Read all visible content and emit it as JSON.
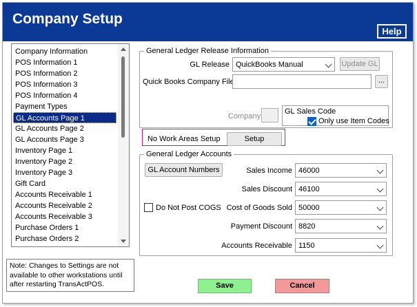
{
  "window": {
    "title": "Company Setup",
    "help_label": "Help",
    "colors": {
      "titlebar": "#0a3a96",
      "selection": "#0a2a8a",
      "save": "#8ef08e",
      "cancel": "#f29a9a",
      "highlight_border": "#c81c6a"
    }
  },
  "sidebar": {
    "items": [
      "Company Information",
      "POS Information 1",
      "POS Information 2",
      "POS Information 3",
      "POS Information 4",
      "Payment Types",
      "GL Accounts Page 1",
      "GL Accounts Page 2",
      "GL Accounts Page 3",
      "Inventory Page 1",
      "Inventory Page 2",
      "Inventory Page 3",
      "Gift Card",
      "Accounts Receivable 1",
      "Accounts Receivable 2",
      "Accounts Receivable 3",
      "Purchase Orders 1",
      "Purchase Orders 2"
    ],
    "selected": "GL Accounts Page 1"
  },
  "note": "Note: Changes to Settings are not available to other workstations until after restarting TransActPOS.",
  "gl_release": {
    "legend": "General Ledger Release Information",
    "gl_release_label": "GL Release",
    "gl_release_value": "QuickBooks Manual",
    "update_gl_label": "Update GL",
    "qb_file_label": "Quick Books Company File",
    "qb_file_value": "",
    "browse_label": "...",
    "company_label": "Company",
    "sales_code_label": "GL Sales Code",
    "only_item_codes_label": "Only use Item Codes",
    "only_item_codes_checked": true
  },
  "work_areas": {
    "label": "No Work Areas Setup",
    "setup_label": "Setup"
  },
  "gl_accounts": {
    "legend": "General Ledger Accounts",
    "numbers_button": "GL Account Numbers",
    "do_not_post_cogs_label": "Do Not Post COGS",
    "do_not_post_cogs_checked": false,
    "fields": [
      {
        "label": "Sales Income",
        "value": "46000"
      },
      {
        "label": "Sales Discount",
        "value": "46100"
      },
      {
        "label": "Cost of Goods Sold",
        "value": "50000"
      },
      {
        "label": "Payment Discount",
        "value": "8820"
      },
      {
        "label": "Accounts Receivable",
        "value": "1150"
      }
    ]
  },
  "footer": {
    "save_label": "Save",
    "cancel_label": "Cancel"
  }
}
